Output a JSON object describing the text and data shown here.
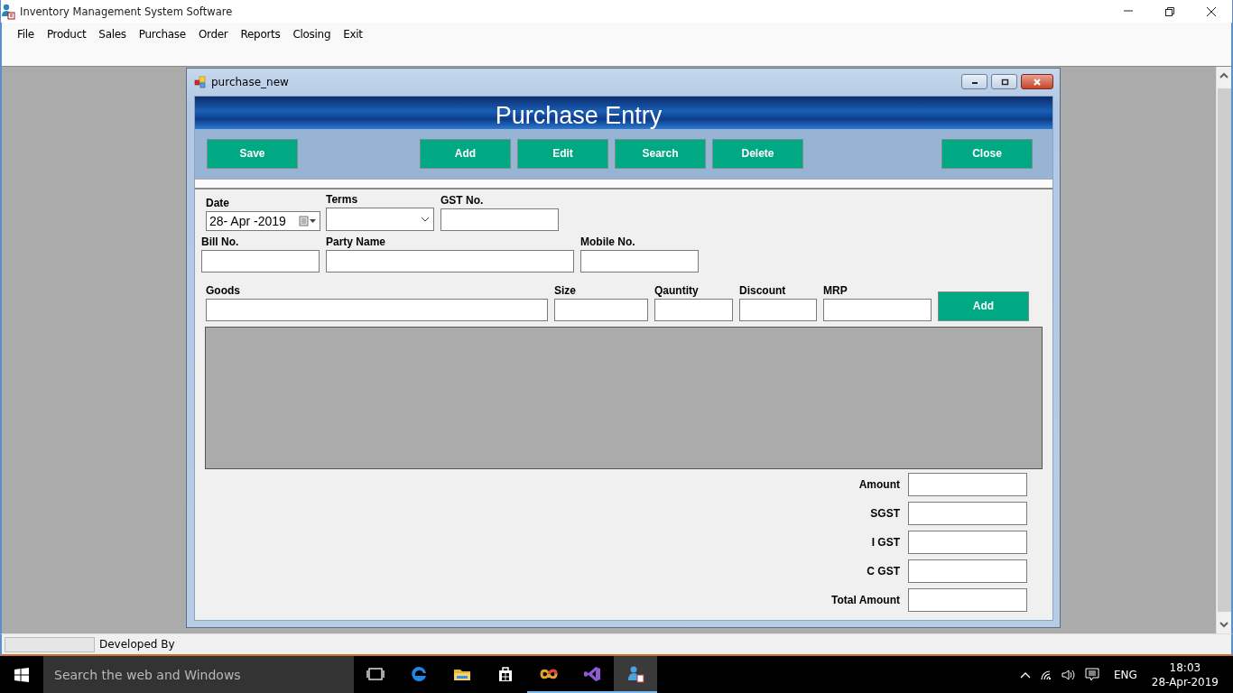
{
  "window": {
    "title": "Inventory Management System Software"
  },
  "menu": [
    "File",
    "Product",
    "Sales",
    "Purchase",
    "Order",
    "Reports",
    "Closing",
    "Exit"
  ],
  "child_window": {
    "title": "purchase_new",
    "header": "Purchase Entry",
    "toolbar": [
      "Save",
      "Add",
      "Edit",
      "Search",
      "Delete",
      "Close"
    ],
    "rows": [
      [
        {
          "kind": "date",
          "label": "Date",
          "value": "28- Apr -2019"
        },
        {
          "kind": "combo",
          "label": "Terms"
        },
        {
          "kind": "text",
          "label": "GST No."
        }
      ],
      [
        {
          "kind": "text",
          "label": "Bill No."
        },
        {
          "kind": "text",
          "label": "Party Name"
        },
        {
          "kind": "text",
          "label": "Mobile No."
        }
      ],
      [
        {
          "kind": "text",
          "label": "Goods"
        },
        {
          "kind": "text",
          "label": "Size"
        },
        {
          "kind": "text",
          "label": "Qauntity"
        },
        {
          "kind": "text",
          "label": "Discount"
        },
        {
          "kind": "text",
          "label": "MRP"
        },
        {
          "kind": "button",
          "label": "Add"
        }
      ]
    ],
    "totals": [
      "Amount",
      "SGST",
      "I GST",
      "C GST",
      "Total Amount"
    ]
  },
  "status_bar": {
    "progress": {
      "level": 0
    },
    "text": "Developed By"
  },
  "taskbar": {
    "search_placeholder": "Search the web and Windows",
    "apps": [
      {
        "kind": "taskview",
        "running": false,
        "active": false
      },
      {
        "kind": "browser",
        "running": false,
        "active": false
      },
      {
        "kind": "folder",
        "running": false,
        "active": false
      },
      {
        "kind": "store",
        "running": false,
        "active": false
      },
      {
        "kind": "infinity",
        "running": true,
        "active": false
      },
      {
        "kind": "studio",
        "running": true,
        "active": false
      },
      {
        "kind": "inventory",
        "running": true,
        "active": true
      }
    ],
    "language": "ENG",
    "time": "18:03",
    "date": "28-Apr-2019"
  }
}
